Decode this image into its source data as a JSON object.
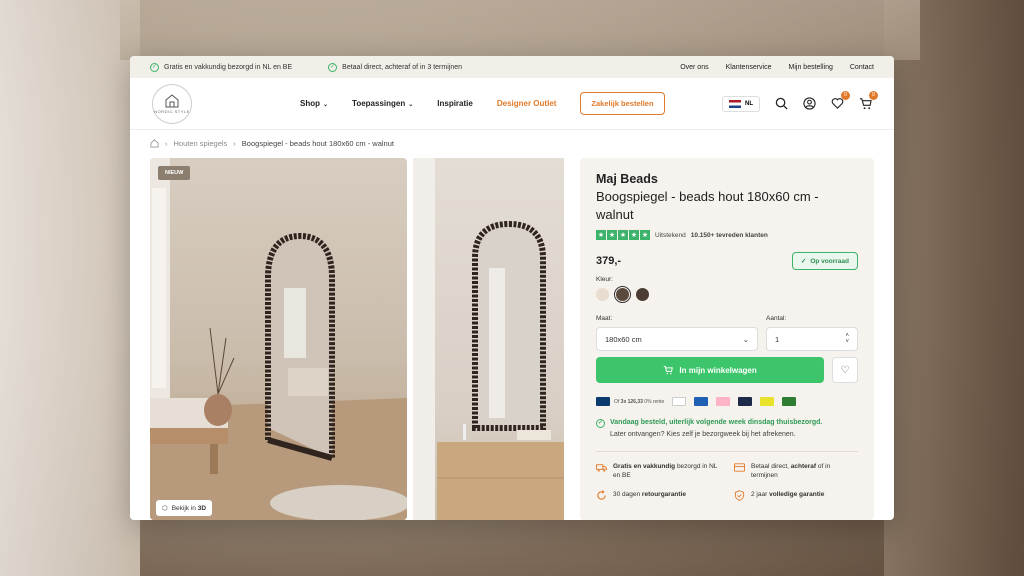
{
  "topbar": {
    "usp1": "Gratis en vakkundig bezorgd in NL en BE",
    "usp2": "Betaal direct, achteraf of in 3 termijnen",
    "links": [
      "Over ons",
      "Klantenservice",
      "Mijn bestelling",
      "Contact"
    ]
  },
  "logo": {
    "text": "NORDIC STYLE"
  },
  "nav": {
    "items": [
      "Shop",
      "Toepassingen",
      "Inspiratie"
    ],
    "outlet": "Designer Outlet",
    "business_button": "Zakelijk bestellen",
    "language": "NL",
    "wishlist_count": "0",
    "cart_count": "0"
  },
  "breadcrumb": {
    "category": "Houten spiegels",
    "current": "Boogspiegel - beads hout 180x60 cm - walnut"
  },
  "gallery": {
    "badge": "NIEUW",
    "view3d_prefix": "Bekijk in ",
    "view3d_bold": "3D"
  },
  "product": {
    "brand": "Maj Beads",
    "title": "Boogspiegel - beads hout 180x60 cm - walnut",
    "rating_text": "Uitstekend",
    "rating_count": "10.150+ tevreden klanten",
    "price": "379,-",
    "stock": "Op voorraad",
    "color_label": "Kleur:",
    "colors": [
      "#e8ddd0",
      "#5a4a3e",
      "#4b3d33"
    ],
    "size_label": "Maat:",
    "size_value": "180x60 cm",
    "qty_label": "Aantal:",
    "qty_value": "1",
    "add_to_cart": "In mijn winkelwagen",
    "installment_prefix": "Of ",
    "installment_bold": "3x 126,33",
    "installment_suffix": " 0% rente",
    "payment_methods": [
      "iDEAL",
      "Apple Pay",
      "PayPal",
      "Klarna",
      "Bancontact",
      "Wero",
      "Credit"
    ],
    "delivery_green": "Vandaag besteld, uiterlijk volgende week dinsdag thuisbezorgd.",
    "delivery_text": "Later ontvangen? Kies zelf je bezorgweek bij het afrekenen.",
    "usps": [
      {
        "bold": "Gratis en vakkundig",
        "text": " bezorgd in NL en BE"
      },
      {
        "pre": "Betaal direct, ",
        "bold": "achteraf",
        "text": " of in termijnen"
      },
      {
        "pre": "30 dagen ",
        "bold": "retourgarantie",
        "text": ""
      },
      {
        "pre": "2 jaar ",
        "bold": "volledige garantie",
        "text": ""
      }
    ]
  },
  "colors": {
    "accent": "#e07a2a",
    "green": "#3cc56a",
    "panel": "#f6f2ed"
  }
}
